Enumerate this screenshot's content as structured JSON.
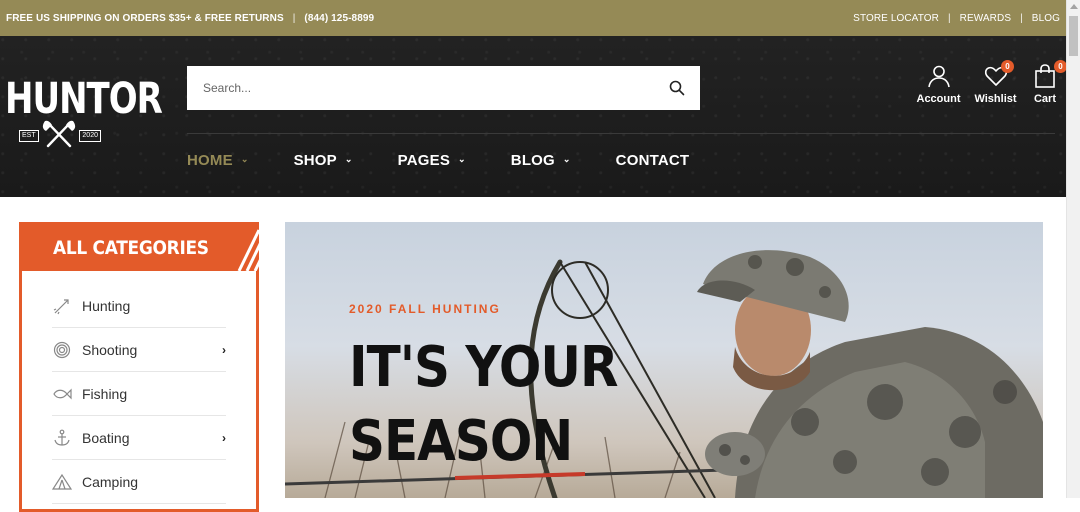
{
  "topbar": {
    "promo": "FREE US SHIPPING ON ORDERS $35+ & FREE RETURNS",
    "separator": "|",
    "phone": "(844) 125-8899",
    "links": [
      "STORE LOCATOR",
      "REWARDS",
      "BLOG"
    ]
  },
  "brand": {
    "name": "HUNTOR",
    "est": "EST",
    "year": "2020",
    "emblem_icon": "crossed-axes-icon"
  },
  "search": {
    "placeholder": "Search...",
    "icon": "search-icon"
  },
  "header_actions": {
    "account": {
      "label": "Account",
      "icon": "user-icon"
    },
    "wishlist": {
      "label": "Wishlist",
      "icon": "heart-icon",
      "count": "0"
    },
    "cart": {
      "label": "Cart",
      "icon": "shopping-bag-icon",
      "count": "0"
    }
  },
  "nav": [
    {
      "label": "HOME",
      "has_dropdown": true,
      "active": true
    },
    {
      "label": "SHOP",
      "has_dropdown": true
    },
    {
      "label": "PAGES",
      "has_dropdown": true
    },
    {
      "label": "BLOG",
      "has_dropdown": true
    },
    {
      "label": "CONTACT",
      "has_dropdown": false
    }
  ],
  "categories": {
    "title": "ALL CATEGORIES",
    "items": [
      {
        "label": "Hunting",
        "icon": "arrow-icon",
        "has_submenu": false
      },
      {
        "label": "Shooting",
        "icon": "target-icon",
        "has_submenu": true
      },
      {
        "label": "Fishing",
        "icon": "fish-icon",
        "has_submenu": false
      },
      {
        "label": "Boating",
        "icon": "anchor-icon",
        "has_submenu": true
      },
      {
        "label": "Camping",
        "icon": "tent-icon",
        "has_submenu": false
      }
    ]
  },
  "hero": {
    "subtitle": "2020 FALL HUNTING",
    "title_line1": "IT'S YOUR",
    "title_line2": "SEASON"
  },
  "colors": {
    "topbar": "#958a56",
    "header": "#1c1c1c",
    "accent": "#e35b2a",
    "nav_active": "#958a56"
  }
}
